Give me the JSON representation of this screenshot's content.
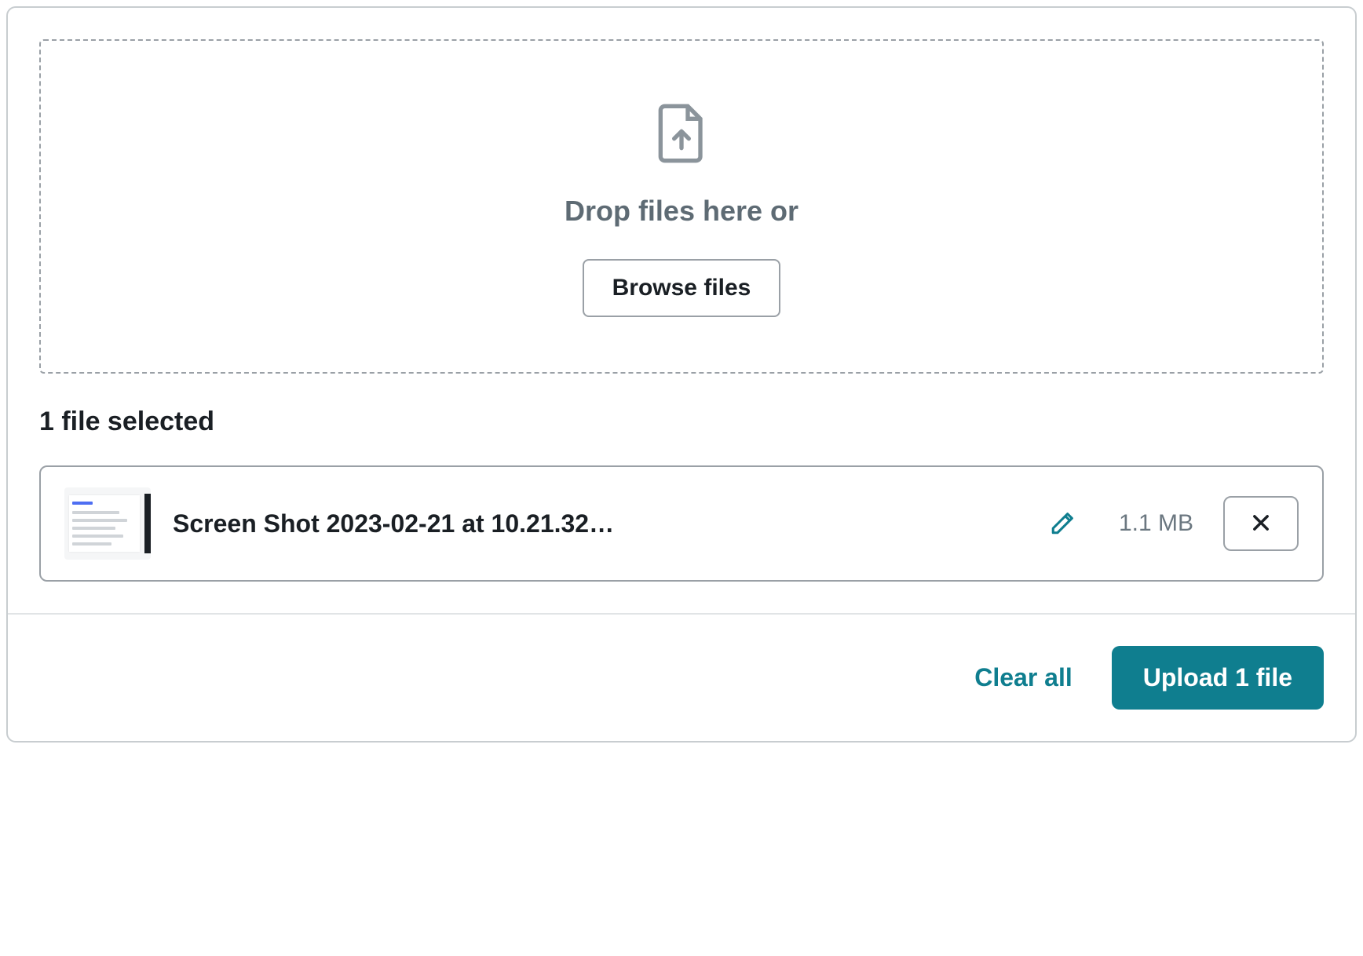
{
  "dropzone": {
    "prompt": "Drop files here or",
    "browse_label": "Browse files"
  },
  "selected": {
    "heading": "1 file selected"
  },
  "files": [
    {
      "name": "Screen Shot 2023-02-21 at 10.21.32…",
      "size": "1.1 MB"
    }
  ],
  "footer": {
    "clear_label": "Clear all",
    "upload_label": "Upload 1 file"
  },
  "colors": {
    "accent": "#0f7e8f",
    "border": "#9aa0a6",
    "text_primary": "#1a1f24",
    "text_muted": "#5e6b74"
  }
}
